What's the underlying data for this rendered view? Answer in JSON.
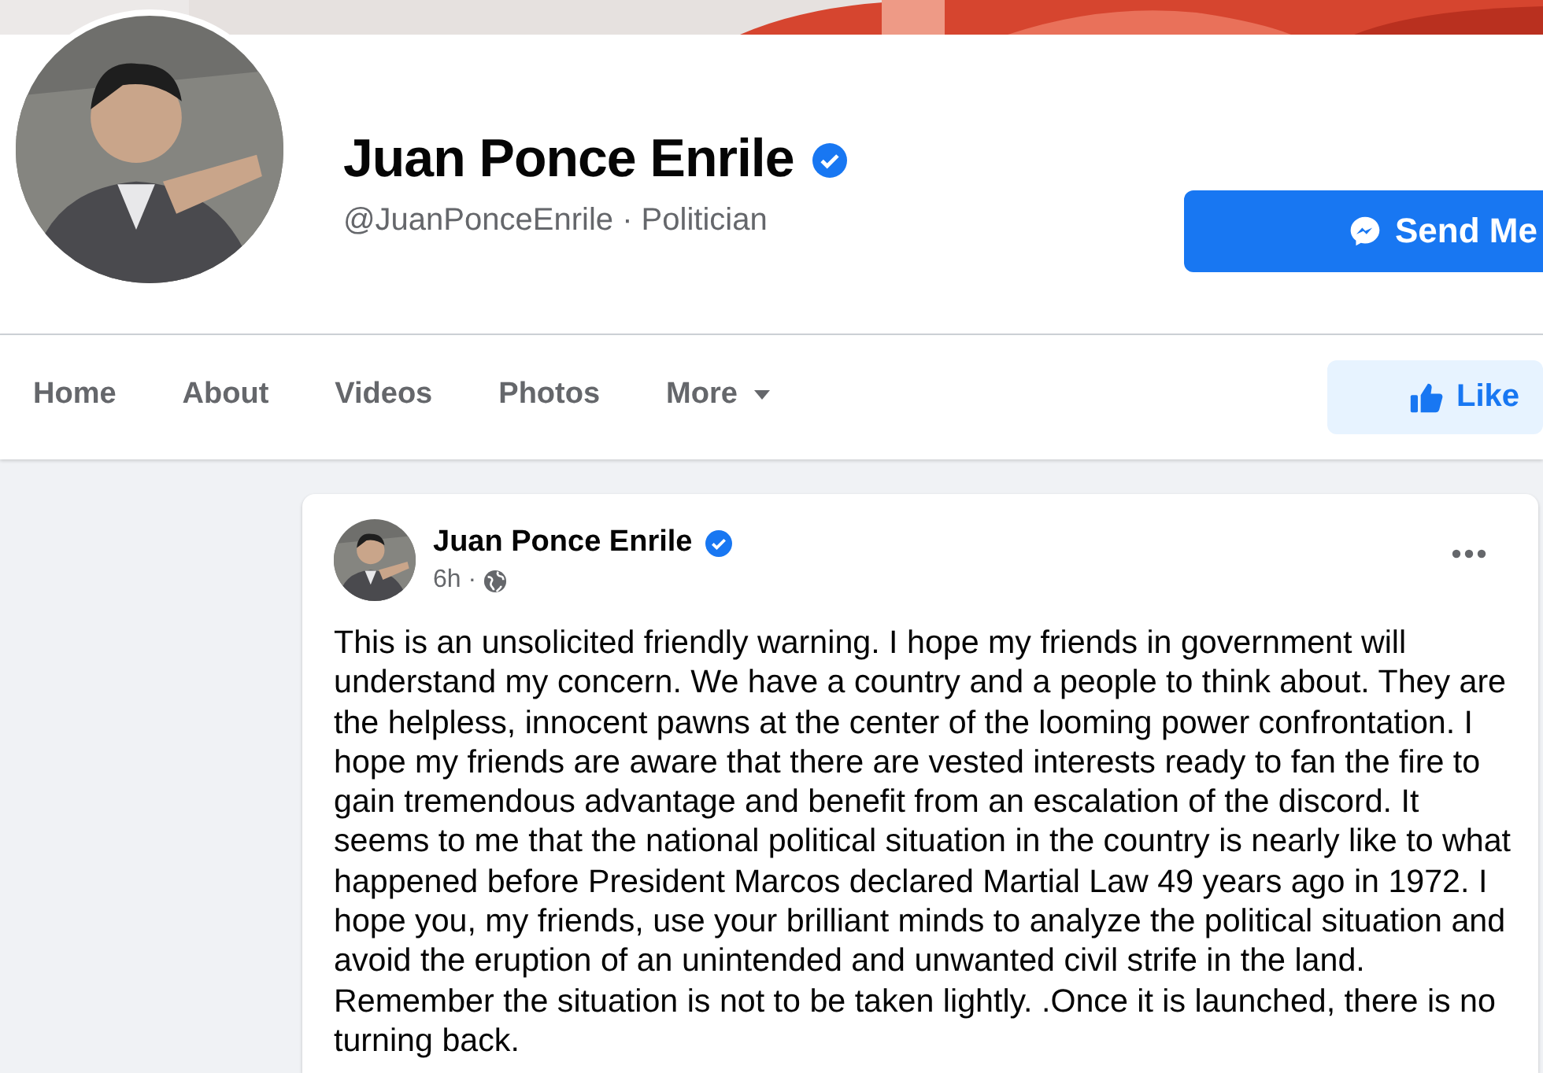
{
  "profile": {
    "name": "Juan Ponce Enrile",
    "verified": true,
    "handle": "@JuanPonceEnrile · Politician",
    "send_button": "Send Me"
  },
  "tabs": [
    {
      "label": "Home",
      "selected": false
    },
    {
      "label": "About",
      "selected": false
    },
    {
      "label": "Videos",
      "selected": false
    },
    {
      "label": "Photos",
      "selected": false
    },
    {
      "label": "More",
      "selected": false,
      "dropdown": true
    }
  ],
  "like_button": "Like",
  "post": {
    "author": "Juan Ponce Enrile",
    "verified": true,
    "time": "6h ·",
    "body": "This is an unsolicited friendly warning. I hope my friends in government will understand my concern. We have a country and a people to think about. They are the helpless, innocent pawns at the center of the looming power confrontation. I hope my friends are aware that there are vested interests ready to fan the fire to gain tremendous advantage and benefit from an escalation of the discord. It seems to me that the national political situation in the country is nearly like to what happened before President Marcos declared Martial Law 49 years ago in 1972. I hope you, my friends, use your brilliant minds to analyze the political situation and avoid the eruption of an unintended and unwanted civil strife in the land. Remember the situation is not to be taken lightly. .Once it is launched, there is no turning back."
  }
}
